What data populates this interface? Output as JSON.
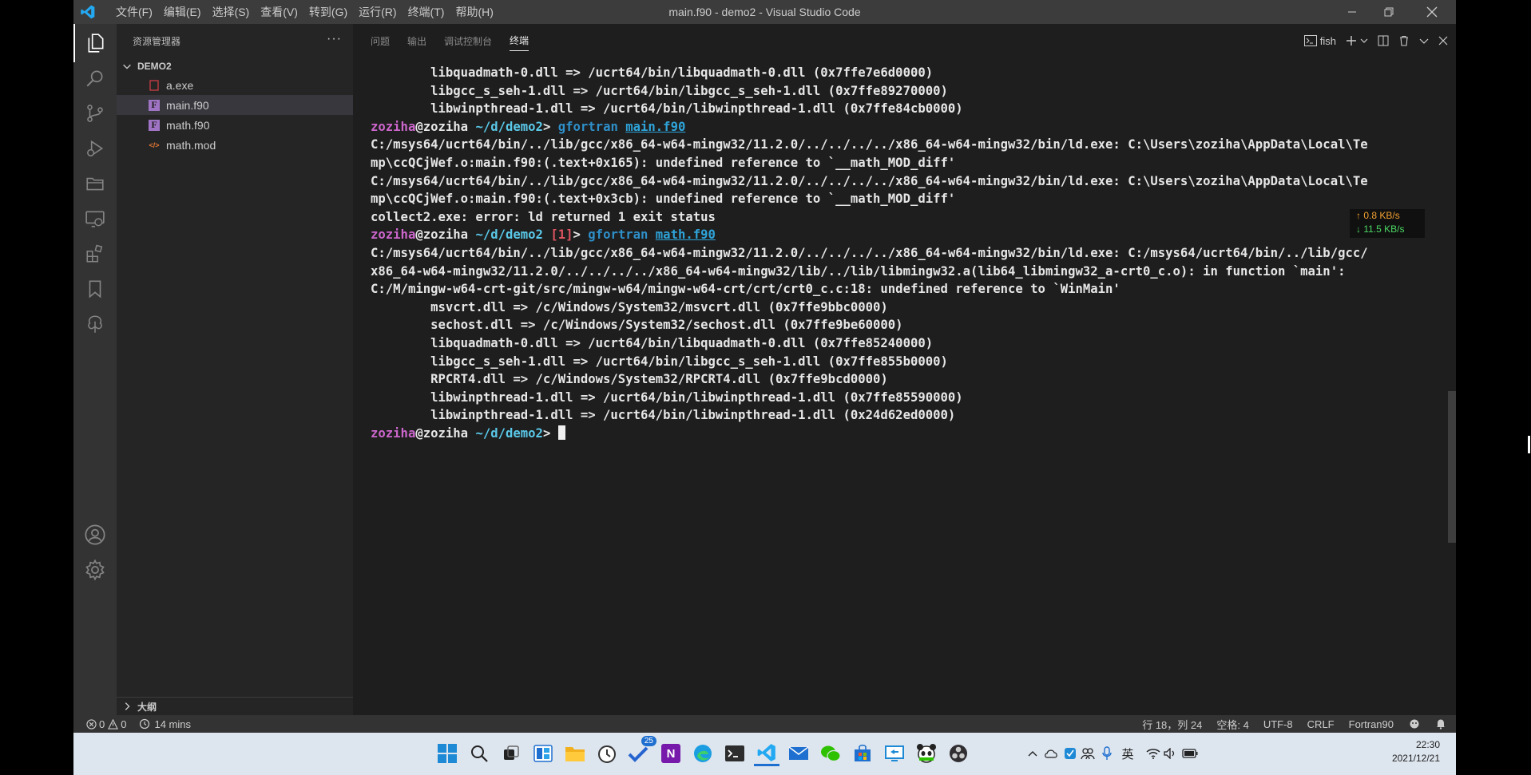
{
  "window": {
    "title": "main.f90 - demo2 - Visual Studio Code",
    "menu": [
      "文件(F)",
      "编辑(E)",
      "选择(S)",
      "查看(V)",
      "转到(G)",
      "运行(R)",
      "终端(T)",
      "帮助(H)"
    ]
  },
  "activity_bar": {
    "items": [
      "explorer-icon",
      "search-icon",
      "source-control-icon",
      "run-debug-icon",
      "remote-explorer-icon",
      "remote-icon",
      "extensions-icon",
      "bookmarks-icon",
      "tree-icon"
    ],
    "bottom": [
      "account-icon",
      "settings-gear-icon"
    ]
  },
  "sidebar": {
    "title": "资源管理器",
    "more": "···",
    "folder": "DEMO2",
    "files": [
      {
        "name": "a.exe",
        "icon": "exe-file-icon",
        "glyph": "",
        "color": "#cc3e44"
      },
      {
        "name": "main.f90",
        "icon": "fortran-file-icon",
        "glyph": "F",
        "color": "#a074c4"
      },
      {
        "name": "math.f90",
        "icon": "fortran-file-icon",
        "glyph": "F",
        "color": "#a074c4"
      },
      {
        "name": "math.mod",
        "icon": "code-file-icon",
        "glyph": "</>",
        "color": "#e37933"
      }
    ],
    "selected_file": "main.f90",
    "outline_label": "大纲"
  },
  "panel": {
    "tabs": [
      {
        "label": "问题",
        "active": false
      },
      {
        "label": "输出",
        "active": false
      },
      {
        "label": "调试控制台",
        "active": false
      },
      {
        "label": "终端",
        "active": true
      }
    ],
    "shell": "fish"
  },
  "terminal": {
    "lines": [
      [
        {
          "t": "        libquadmath-0.dll => /ucrt64/bin/libquadmath-0.dll (0x7ffe7e6d0000)"
        }
      ],
      [
        {
          "t": "        libgcc_s_seh-1.dll => /ucrt64/bin/libgcc_s_seh-1.dll (0x7ffe89270000)"
        }
      ],
      [
        {
          "t": "        libwinpthread-1.dll => /ucrt64/bin/libwinpthread-1.dll (0x7ffe84cb0000)"
        }
      ],
      [
        {
          "t": "zoziha",
          "c": "pu"
        },
        {
          "t": "@zoziha "
        },
        {
          "t": "~/d/demo2",
          "c": "cy"
        },
        {
          "t": "> "
        },
        {
          "t": "gfortran",
          "c": "cmd"
        },
        {
          "t": " "
        },
        {
          "t": "main.f90",
          "c": "arg"
        }
      ],
      [
        {
          "t": "C:/msys64/ucrt64/bin/../lib/gcc/x86_64-w64-mingw32/11.2.0/../../../../x86_64-w64-mingw32/bin/ld.exe: C:\\Users\\zoziha\\AppData\\Local\\Te"
        }
      ],
      [
        {
          "t": "mp\\ccQCjWef.o:main.f90:(.text+0x165): undefined reference to `__math_MOD_diff'"
        }
      ],
      [
        {
          "t": "C:/msys64/ucrt64/bin/../lib/gcc/x86_64-w64-mingw32/11.2.0/../../../../x86_64-w64-mingw32/bin/ld.exe: C:\\Users\\zoziha\\AppData\\Local\\Te"
        }
      ],
      [
        {
          "t": "mp\\ccQCjWef.o:main.f90:(.text+0x3cb): undefined reference to `__math_MOD_diff'"
        }
      ],
      [
        {
          "t": "collect2.exe: error: ld returned 1 exit status"
        }
      ],
      [
        {
          "t": "zoziha",
          "c": "pu"
        },
        {
          "t": "@zoziha "
        },
        {
          "t": "~/d/demo2",
          "c": "cy"
        },
        {
          "t": " "
        },
        {
          "t": "[1]",
          "c": "err"
        },
        {
          "t": "> "
        },
        {
          "t": "gfortran",
          "c": "cmd"
        },
        {
          "t": " "
        },
        {
          "t": "math.f90",
          "c": "arg"
        }
      ],
      [
        {
          "t": "C:/msys64/ucrt64/bin/../lib/gcc/x86_64-w64-mingw32/11.2.0/../../../../x86_64-w64-mingw32/bin/ld.exe: C:/msys64/ucrt64/bin/../lib/gcc/"
        }
      ],
      [
        {
          "t": "x86_64-w64-mingw32/11.2.0/../../../../x86_64-w64-mingw32/lib/../lib/libmingw32.a(lib64_libmingw32_a-crt0_c.o): in function `main':"
        }
      ],
      [
        {
          "t": "C:/M/mingw-w64-crt-git/src/mingw-w64/mingw-w64-crt/crt/crt0_c.c:18: undefined reference to `WinMain'"
        }
      ],
      [
        {
          "t": "        msvcrt.dll => /c/Windows/System32/msvcrt.dll (0x7ffe9bbc0000)"
        }
      ],
      [
        {
          "t": "        sechost.dll => /c/Windows/System32/sechost.dll (0x7ffe9be60000)"
        }
      ],
      [
        {
          "t": "        libquadmath-0.dll => /ucrt64/bin/libquadmath-0.dll (0x7ffe85240000)"
        }
      ],
      [
        {
          "t": "        libgcc_s_seh-1.dll => /ucrt64/bin/libgcc_s_seh-1.dll (0x7ffe855b0000)"
        }
      ],
      [
        {
          "t": "        RPCRT4.dll => /c/Windows/System32/RPCRT4.dll (0x7ffe9bcd0000)"
        }
      ],
      [
        {
          "t": "        libwinpthread-1.dll => /ucrt64/bin/libwinpthread-1.dll (0x7ffe85590000)"
        }
      ],
      [
        {
          "t": "        libwinpthread-1.dll => /ucrt64/bin/libwinpthread-1.dll (0x24d62ed0000)"
        }
      ],
      [
        {
          "t": "zoziha",
          "c": "pu"
        },
        {
          "t": "@zoziha "
        },
        {
          "t": "~/d/demo2",
          "c": "cy"
        },
        {
          "t": "> "
        }
      ]
    ]
  },
  "net_speed": {
    "up": "↑ 0.8 KB/s",
    "down": "↓ 11.5 KB/s",
    "up_color": "#f0a030",
    "down_color": "#4cd964"
  },
  "status_bar": {
    "errors": "0",
    "warnings": "0",
    "timer": "14 mins",
    "position": "行 18，列 24",
    "spaces": "空格: 4",
    "encoding": "UTF-8",
    "eol": "CRLF",
    "language": "Fortran90"
  },
  "taskbar": {
    "apps": [
      "windows-start-icon",
      "search-icon",
      "task-view-icon",
      "widgets-icon",
      "file-explorer-icon",
      "clock-app-icon",
      "todo-icon",
      "onenote-icon",
      "edge-icon",
      "terminal-icon",
      "vscode-icon",
      "mail-icon",
      "wechat-icon",
      "store-icon",
      "remote-desktop-icon",
      "panda-app-icon",
      "obs-icon"
    ],
    "todo_badge": "25",
    "onenote_letter": "N",
    "tray": [
      "chevron-up-icon",
      "onedrive-icon",
      "app-tray-icon",
      "people-tray-icon",
      "microphone-icon",
      "英",
      "wifi-icon",
      "volume-icon",
      "battery-icon"
    ],
    "time": "22:30",
    "date": "2021/12/21"
  },
  "colors": {
    "accent": "#007acc",
    "terminal_bg": "#1e1e1e",
    "sidebar_bg": "#252526"
  }
}
